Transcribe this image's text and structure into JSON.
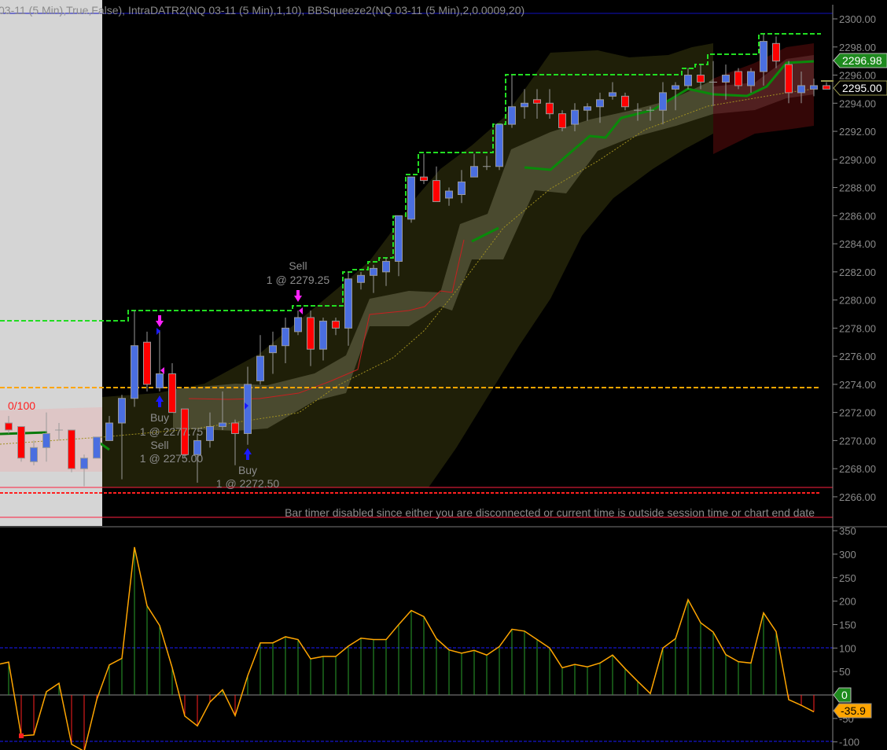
{
  "header": {
    "indicator_text": "03-11 (5 Min),True,False), IntraDATR2(NQ 03-11 (5 Min),1,10), BBSqueeze2(NQ 03-11 (5 Min),2,0.0009,20)"
  },
  "colors": {
    "up": "#4a6ee0",
    "down": "#ff0000",
    "donchian": "#22dd22",
    "orange_level": "#ffa500",
    "red_level": "#ff2040",
    "osc_line": "#ffa500",
    "osc_pos": "#2aa02a",
    "osc_neg": "#ff2020"
  },
  "labels": {
    "ratio": "0/100",
    "bar_timer": "Bar timer disabled since either you are disconnected or current time is outside session time or chart end date",
    "last_price_green": "2296.98",
    "last_price": "2295.00",
    "osc_zero_label": "0",
    "osc_last_label": "-35.9"
  },
  "trades": [
    {
      "side": "Sell",
      "detail": "1 @ 2279.25"
    },
    {
      "side": "Buy",
      "detail": "1 @ 2277.75"
    },
    {
      "side": "Sell",
      "detail": "1 @ 2275.00"
    },
    {
      "side": "Buy",
      "detail": "1 @ 2272.50"
    }
  ],
  "chart_data": [
    {
      "type": "candlestick",
      "title": "NQ 03-11 (5 Min)",
      "ylim": [
        2265,
        2301
      ],
      "y_ticks": [
        "2300.00",
        "2298.00",
        "2296.00",
        "2294.00",
        "2292.00",
        "2290.00",
        "2288.00",
        "2286.00",
        "2284.00",
        "2282.00",
        "2280.00",
        "2278.00",
        "2276.00",
        "2274.00",
        "2272.00",
        "2270.00",
        "2268.00",
        "2266.00"
      ],
      "levels": {
        "orange": 2273.75,
        "red_dashed": 2266.25
      },
      "ohlc": [
        [
          2271.25,
          2271.75,
          2270.5,
          2270.75
        ],
        [
          2271.0,
          2271.0,
          2268.5,
          2268.75
        ],
        [
          2268.5,
          2270.0,
          2268.25,
          2269.5
        ],
        [
          2269.5,
          2272.0,
          2268.5,
          2270.5
        ],
        [
          2270.75,
          2271.25,
          2270.0,
          2270.75
        ],
        [
          2270.75,
          2270.75,
          2267.75,
          2268.0
        ],
        [
          2268.0,
          2269.0,
          2266.75,
          2268.75
        ],
        [
          2268.75,
          2270.25,
          2268.75,
          2270.25
        ],
        [
          2270.0,
          2271.75,
          2270.0,
          2271.25
        ],
        [
          2271.25,
          2273.25,
          2267.25,
          2273.0
        ],
        [
          2273.0,
          2279.25,
          2272.4,
          2276.75
        ],
        [
          2277.0,
          2277.75,
          2273.5,
          2274.0
        ],
        [
          2273.75,
          2277.85,
          2273.5,
          2274.75
        ],
        [
          2274.75,
          2275.5,
          2272.0,
          2272.0
        ],
        [
          2272.25,
          2272.25,
          2268.75,
          2269.0
        ],
        [
          2269.0,
          2270.5,
          2267.0,
          2270.0
        ],
        [
          2270.0,
          2272.0,
          2269.5,
          2271.0
        ],
        [
          2271.0,
          2273.5,
          2270.75,
          2271.25
        ],
        [
          2271.25,
          2271.5,
          2268.25,
          2270.5
        ],
        [
          2270.5,
          2275.25,
          2269.7,
          2274.0
        ],
        [
          2274.25,
          2277.5,
          2274.0,
          2276.0
        ],
        [
          2276.25,
          2277.75,
          2274.75,
          2276.75
        ],
        [
          2276.75,
          2278.75,
          2275.5,
          2278.0
        ],
        [
          2277.75,
          2279.25,
          2277.5,
          2278.75
        ],
        [
          2278.75,
          2279.25,
          2275.3,
          2276.5
        ],
        [
          2276.5,
          2278.75,
          2275.7,
          2278.5
        ],
        [
          2278.5,
          2278.75,
          2277.5,
          2278.0
        ],
        [
          2278.0,
          2282.0,
          2276.75,
          2281.5
        ],
        [
          2281.25,
          2282.0,
          2280.75,
          2281.75
        ],
        [
          2281.75,
          2282.5,
          2280.5,
          2282.25
        ],
        [
          2282.0,
          2283.0,
          2281.0,
          2282.75
        ],
        [
          2282.75,
          2286.0,
          2281.7,
          2286.0
        ],
        [
          2285.75,
          2288.75,
          2285.5,
          2288.75
        ],
        [
          2288.75,
          2290.4,
          2288.25,
          2288.5
        ],
        [
          2288.5,
          2289.5,
          2287.0,
          2287.0
        ],
        [
          2287.25,
          2288.0,
          2286.7,
          2287.75
        ],
        [
          2287.5,
          2289.25,
          2286.9,
          2288.4
        ],
        [
          2288.75,
          2290.4,
          2288.75,
          2289.5
        ],
        [
          2289.5,
          2290.25,
          2289.25,
          2289.5
        ],
        [
          2289.5,
          2292.5,
          2289.25,
          2292.5
        ],
        [
          2292.5,
          2296.0,
          2292.25,
          2293.75
        ],
        [
          2293.75,
          2295.0,
          2292.9,
          2294.0
        ],
        [
          2294.25,
          2295.0,
          2292.9,
          2294.0
        ],
        [
          2294.0,
          2295.0,
          2292.9,
          2293.25
        ],
        [
          2293.25,
          2293.5,
          2292.0,
          2292.25
        ],
        [
          2292.5,
          2294.0,
          2292.0,
          2293.5
        ],
        [
          2293.5,
          2294.0,
          2292.75,
          2293.75
        ],
        [
          2293.75,
          2294.75,
          2292.6,
          2294.25
        ],
        [
          2294.5,
          2295.5,
          2294.25,
          2294.75
        ],
        [
          2294.5,
          2294.75,
          2293.5,
          2293.75
        ],
        [
          2293.5,
          2294.0,
          2292.75,
          2293.5
        ],
        [
          2293.5,
          2293.75,
          2292.75,
          2293.5
        ],
        [
          2293.5,
          2295.5,
          2292.5,
          2294.75
        ],
        [
          2295.0,
          2295.5,
          2293.5,
          2295.25
        ],
        [
          2295.25,
          2296.5,
          2295.0,
          2296.0
        ],
        [
          2296.0,
          2296.75,
          2295.0,
          2295.5
        ],
        [
          2295.5,
          2297.0,
          2293.8,
          2295.5
        ],
        [
          2295.5,
          2296.75,
          2294.25,
          2296.0
        ],
        [
          2296.25,
          2296.5,
          2295.0,
          2295.25
        ],
        [
          2295.25,
          2296.5,
          2294.75,
          2296.25
        ],
        [
          2296.25,
          2298.9,
          2295.25,
          2298.4
        ],
        [
          2298.25,
          2298.75,
          2296.5,
          2297.0
        ],
        [
          2296.75,
          2297.0,
          2294.0,
          2294.75
        ],
        [
          2294.75,
          2296.25,
          2294.0,
          2295.25
        ],
        [
          2295.0,
          2295.75,
          2294.5,
          2295.25
        ],
        [
          2295.25,
          2295.5,
          2295.0,
          2295.0
        ]
      ]
    },
    {
      "type": "line",
      "title": "IntraDATR2 oscillator",
      "ylim": [
        -115,
        360
      ],
      "y_ticks": [
        "350",
        "300",
        "250",
        "200",
        "150",
        "100",
        "50",
        "-50",
        "-100"
      ],
      "reference_lines": [
        100,
        0,
        -100
      ],
      "values": [
        70,
        -87,
        -85,
        7,
        25,
        -105,
        -120,
        -10,
        64,
        78,
        315,
        190,
        148,
        58,
        -45,
        -66,
        -15,
        11,
        -44,
        41,
        111,
        111,
        124,
        118,
        77,
        82,
        82,
        104,
        121,
        118,
        118,
        150,
        180,
        167,
        120,
        96,
        89,
        95,
        85,
        103,
        140,
        136,
        118,
        100,
        58,
        65,
        60,
        68,
        85,
        56,
        29,
        3,
        100,
        120,
        203,
        154,
        134,
        86,
        71,
        68,
        175,
        135,
        -10,
        -22,
        -35.9
      ]
    }
  ]
}
